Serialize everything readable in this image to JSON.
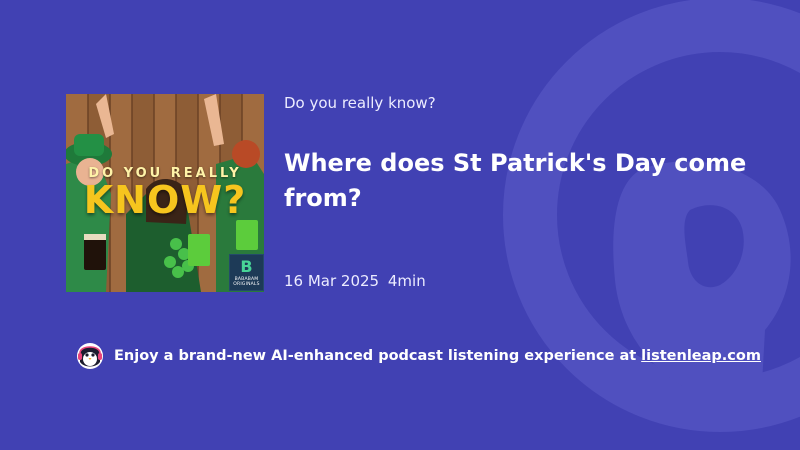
{
  "podcast": {
    "name": "Do you really know?"
  },
  "episode": {
    "title": "Where does St Patrick's Day come from?",
    "date": "16 Mar 2025",
    "duration": "4min"
  },
  "cover": {
    "text_top": "DO YOU REALLY",
    "text_main": "KNOW?",
    "badge_glyph": "B",
    "badge_text": "BABABAM ORIGINALS"
  },
  "promo": {
    "text": "Enjoy a brand-new AI-enhanced podcast listening experience at",
    "link": "listenleap.com",
    "icon": "penguin-icon"
  },
  "colors": {
    "background": "#4141b3",
    "text": "#ffffff",
    "cover_title": "#f6c51e",
    "badge": "#1d3a57"
  }
}
